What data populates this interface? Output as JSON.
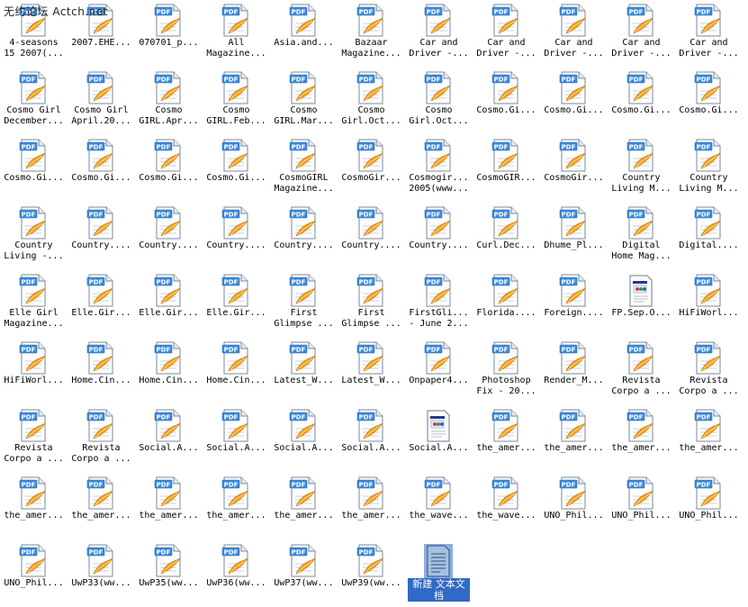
{
  "watermark": "无约论坛 Actch.net",
  "colors": {
    "selection": "#3169c6",
    "pdf_badge": "#3b88d8",
    "acrobat_swoosh": "#f0a020"
  },
  "rows": [
    [
      {
        "label": "4-seasons\n15 2007(...",
        "icon": "pdf-icon"
      },
      {
        "label": "2007.EHE...",
        "icon": "pdf-icon"
      },
      {
        "label": "070701_p...",
        "icon": "pdf-icon"
      },
      {
        "label": "All\nMagazine...",
        "icon": "pdf-icon"
      },
      {
        "label": "Asia.and...",
        "icon": "pdf-icon"
      },
      {
        "label": "Bazaar\nMagazine...",
        "icon": "pdf-icon"
      },
      {
        "label": "Car and\nDriver -...",
        "icon": "pdf-icon"
      },
      {
        "label": "Car and\nDriver -...",
        "icon": "pdf-icon"
      },
      {
        "label": "Car and\nDriver -...",
        "icon": "pdf-icon"
      },
      {
        "label": "Car and\nDriver -...",
        "icon": "pdf-icon"
      },
      {
        "label": "Car and\nDriver -...",
        "icon": "pdf-icon"
      }
    ],
    [
      {
        "label": "Cosmo Girl\nDecember...",
        "icon": "pdf-icon"
      },
      {
        "label": "Cosmo Girl\nApril.20...",
        "icon": "pdf-icon"
      },
      {
        "label": "Cosmo\nGIRL.Apr...",
        "icon": "pdf-icon"
      },
      {
        "label": "Cosmo\nGIRL.Feb...",
        "icon": "pdf-icon"
      },
      {
        "label": "Cosmo\nGIRL.Mar...",
        "icon": "pdf-icon"
      },
      {
        "label": "Cosmo\nGirl.Oct...",
        "icon": "pdf-icon"
      },
      {
        "label": "Cosmo\nGirl.Oct...",
        "icon": "pdf-icon"
      },
      {
        "label": "Cosmo.Gi...",
        "icon": "pdf-icon"
      },
      {
        "label": "Cosmo.Gi...",
        "icon": "pdf-icon"
      },
      {
        "label": "Cosmo.Gi...",
        "icon": "pdf-icon"
      },
      {
        "label": "Cosmo.Gi...",
        "icon": "pdf-icon"
      }
    ],
    [
      {
        "label": "Cosmo.Gi...",
        "icon": "pdf-icon"
      },
      {
        "label": "Cosmo.Gi...",
        "icon": "pdf-icon"
      },
      {
        "label": "Cosmo.Gi...",
        "icon": "pdf-icon"
      },
      {
        "label": "Cosmo.Gi...",
        "icon": "pdf-icon"
      },
      {
        "label": "CosmoGIRL\nMagazine...",
        "icon": "pdf-icon"
      },
      {
        "label": "CosmoGir...",
        "icon": "pdf-icon"
      },
      {
        "label": "Cosmogir...\n2005(www...",
        "icon": "pdf-icon"
      },
      {
        "label": "CosmoGIR...",
        "icon": "pdf-icon"
      },
      {
        "label": "CosmoGir...",
        "icon": "pdf-icon"
      },
      {
        "label": "Country\nLiving M...",
        "icon": "pdf-icon"
      },
      {
        "label": "Country\nLiving M...",
        "icon": "pdf-icon"
      }
    ],
    [
      {
        "label": "Country\nLiving -...",
        "icon": "pdf-icon"
      },
      {
        "label": "Country....",
        "icon": "pdf-icon"
      },
      {
        "label": "Country....",
        "icon": "pdf-icon"
      },
      {
        "label": "Country....",
        "icon": "pdf-icon"
      },
      {
        "label": "Country....",
        "icon": "pdf-icon"
      },
      {
        "label": "Country....",
        "icon": "pdf-icon"
      },
      {
        "label": "Country....",
        "icon": "pdf-icon"
      },
      {
        "label": "Curl.Dec...",
        "icon": "pdf-icon"
      },
      {
        "label": "Dhume_Pl...",
        "icon": "pdf-icon"
      },
      {
        "label": "Digital\nHome Mag...",
        "icon": "pdf-icon"
      },
      {
        "label": "Digital....",
        "icon": "pdf-icon"
      }
    ],
    [
      {
        "label": "Elle Girl\nMagazine...",
        "icon": "pdf-icon"
      },
      {
        "label": "Elle.Gir...",
        "icon": "pdf-icon"
      },
      {
        "label": "Elle.Gir...",
        "icon": "pdf-icon"
      },
      {
        "label": "Elle.Gir...",
        "icon": "pdf-icon"
      },
      {
        "label": "First\nGlimpse ...",
        "icon": "pdf-icon"
      },
      {
        "label": "First\nGlimpse ...",
        "icon": "pdf-icon"
      },
      {
        "label": "FirstGli...\n- June 2...",
        "icon": "pdf-icon"
      },
      {
        "label": "Florida....",
        "icon": "pdf-icon"
      },
      {
        "label": "Foreign....",
        "icon": "pdf-icon"
      },
      {
        "label": "FP.Sep.O...",
        "icon": "generic-file-icon"
      },
      {
        "label": "HiFiWorl...",
        "icon": "pdf-icon"
      }
    ],
    [
      {
        "label": "HiFiWorl...",
        "icon": "pdf-icon"
      },
      {
        "label": "Home.Cin...",
        "icon": "pdf-icon"
      },
      {
        "label": "Home.Cin...",
        "icon": "pdf-icon"
      },
      {
        "label": "Home.Cin...",
        "icon": "pdf-icon"
      },
      {
        "label": "Latest_W...",
        "icon": "pdf-icon"
      },
      {
        "label": "Latest_W...",
        "icon": "pdf-icon"
      },
      {
        "label": "Onpaper4...",
        "icon": "pdf-icon"
      },
      {
        "label": "Photoshop\nFix - 20...",
        "icon": "pdf-icon"
      },
      {
        "label": "Render_M...",
        "icon": "pdf-icon"
      },
      {
        "label": "Revista\nCorpo a ...",
        "icon": "pdf-icon"
      },
      {
        "label": "Revista\nCorpo a ...",
        "icon": "pdf-icon"
      }
    ],
    [
      {
        "label": "Revista\nCorpo a ...",
        "icon": "pdf-icon"
      },
      {
        "label": "Revista\nCorpo a ...",
        "icon": "pdf-icon"
      },
      {
        "label": "Social.A...",
        "icon": "pdf-icon"
      },
      {
        "label": "Social.A...",
        "icon": "pdf-icon"
      },
      {
        "label": "Social.A...",
        "icon": "pdf-icon"
      },
      {
        "label": "Social.A...",
        "icon": "pdf-icon"
      },
      {
        "label": "Social.A...",
        "icon": "generic-file-icon"
      },
      {
        "label": "the_amer...",
        "icon": "pdf-icon"
      },
      {
        "label": "the_amer...",
        "icon": "pdf-icon"
      },
      {
        "label": "the_amer...",
        "icon": "pdf-icon"
      },
      {
        "label": "the_amer...",
        "icon": "pdf-icon"
      }
    ],
    [
      {
        "label": "the_amer...",
        "icon": "pdf-icon"
      },
      {
        "label": "the_amer...",
        "icon": "pdf-icon"
      },
      {
        "label": "the_amer...",
        "icon": "pdf-icon"
      },
      {
        "label": "the_amer...",
        "icon": "pdf-icon"
      },
      {
        "label": "the_amer...",
        "icon": "pdf-icon"
      },
      {
        "label": "the_amer...",
        "icon": "pdf-icon"
      },
      {
        "label": "the_wave...",
        "icon": "pdf-icon"
      },
      {
        "label": "the_wave...",
        "icon": "pdf-icon"
      },
      {
        "label": "UNO_Phil...",
        "icon": "pdf-icon"
      },
      {
        "label": "UNO_Phil...",
        "icon": "pdf-icon"
      },
      {
        "label": "UNO_Phil...",
        "icon": "pdf-icon"
      }
    ],
    [
      {
        "label": "UNO_Phil...",
        "icon": "pdf-icon"
      },
      {
        "label": "UwP33(ww...",
        "icon": "pdf-icon"
      },
      {
        "label": "UwP35(ww...",
        "icon": "pdf-icon"
      },
      {
        "label": "UwP36(ww...",
        "icon": "pdf-icon"
      },
      {
        "label": "UwP37(ww...",
        "icon": "pdf-icon"
      },
      {
        "label": "UwP39(ww...",
        "icon": "pdf-icon"
      },
      {
        "label": "新建 文本文\n档",
        "icon": "text-document-icon",
        "selected": true
      }
    ]
  ]
}
